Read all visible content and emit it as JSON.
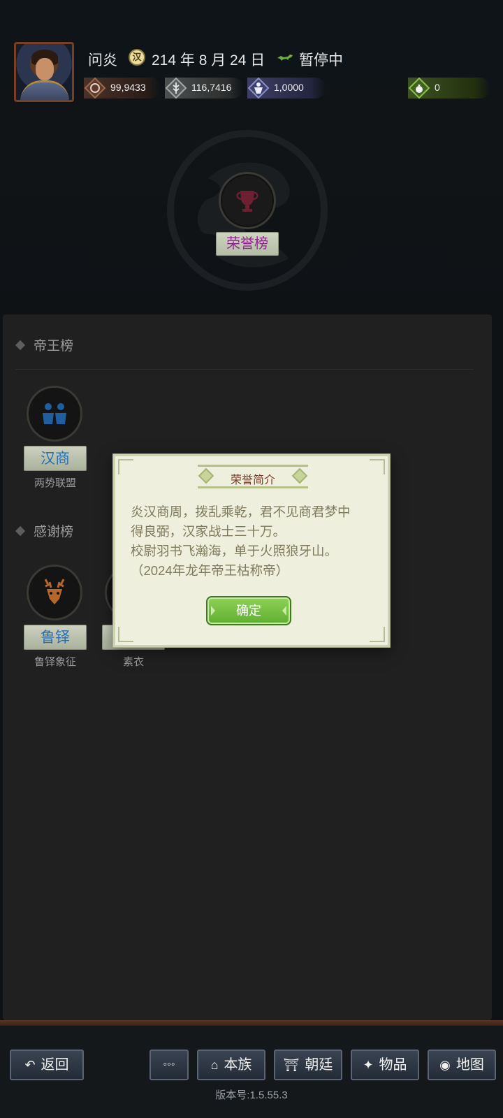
{
  "header": {
    "player_name": "问炎",
    "date_icon_text": "汉",
    "date": "214 年 8 月 24 日",
    "status": "暂停中",
    "resources": {
      "money": "99,9433",
      "grain": "116,7416",
      "troops": "1,0000",
      "gold": "0"
    },
    "trophy_label": "荣誉榜"
  },
  "panel": {
    "section1": {
      "title": "帝王榜",
      "badges": [
        {
          "label": "汉商",
          "sub": "两势联盟"
        }
      ]
    },
    "section2": {
      "title": "感谢榜",
      "badges": [
        {
          "label": "鲁铎",
          "sub": "鲁铎象征"
        },
        {
          "label": "",
          "sub": "素衣"
        }
      ]
    }
  },
  "dialog": {
    "title": "荣誉简介",
    "lines": [
      "炎汉商周，拨乱乘乾，君不见商君梦中",
      "得良弼，汉家战士三十万。",
      "校尉羽书飞瀚海，单于火照狼牙山。",
      "（2024年龙年帝王枯称帝）"
    ],
    "confirm": "确定"
  },
  "bottom_nav": {
    "back": "返回",
    "more": "◦◦◦",
    "clan": "本族",
    "court": "朝廷",
    "items": "物品",
    "map": "地图"
  },
  "version": "版本号:1.5.55.3",
  "colors": {
    "trophy_label": "#8a2a88",
    "badge_label": "#2a6fb0",
    "confirm_green": "#6ebf3e"
  }
}
